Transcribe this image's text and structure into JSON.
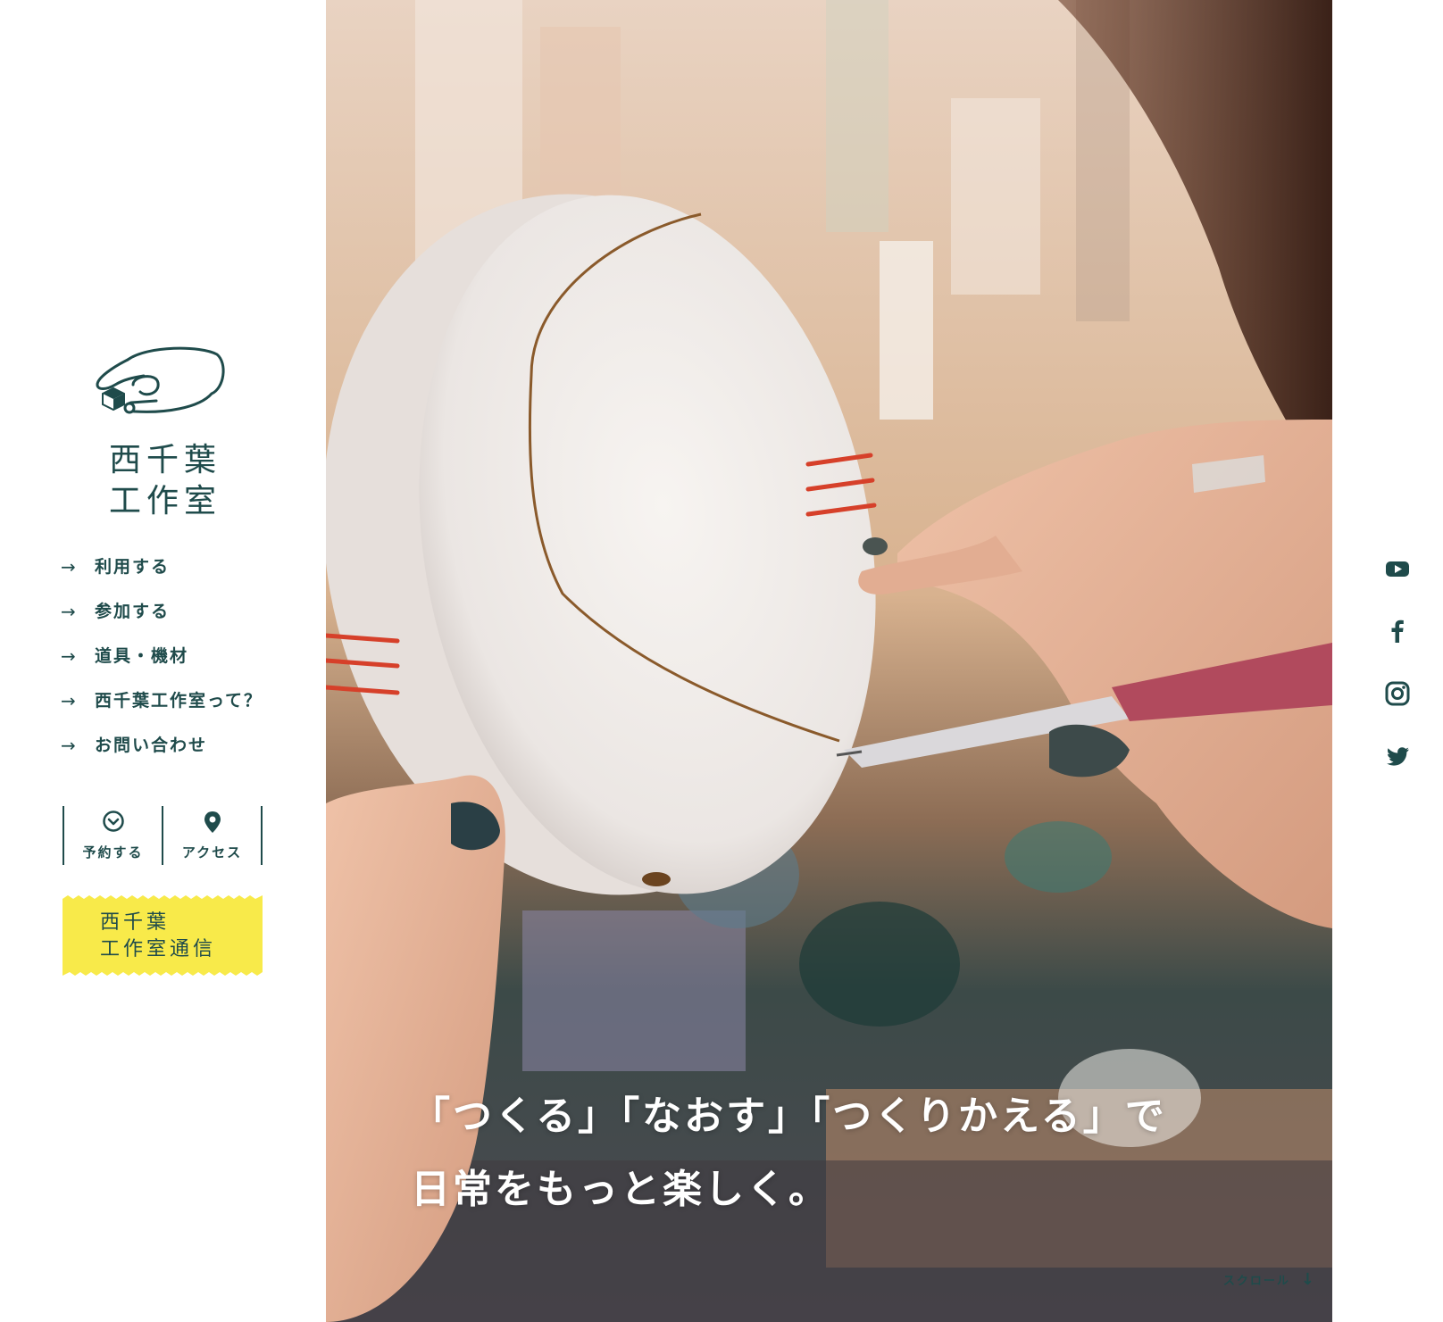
{
  "brand": {
    "logo_text_line1": "西千葉",
    "logo_text_line2": "工作室",
    "primary_color": "#1f4b4b",
    "accent_yellow": "#f8ea4a"
  },
  "nav": {
    "items": [
      {
        "arrow": "→",
        "label": "利用する"
      },
      {
        "arrow": "→",
        "label": "参加する"
      },
      {
        "arrow": "→",
        "label": "道具・機材"
      },
      {
        "arrow": "→",
        "label": "西千葉工作室って？"
      },
      {
        "arrow": "→",
        "label": "お問い合わせ"
      }
    ]
  },
  "quick_links": {
    "reserve": {
      "label": "予約する",
      "icon": "chevron-circle-icon"
    },
    "access": {
      "label": "アクセス",
      "icon": "map-pin-icon"
    }
  },
  "newsletter": {
    "line1": "西千葉",
    "line2": "工作室通信"
  },
  "hero": {
    "tagline_line1": "「つくる」「なおす」「つくりかえる」で",
    "tagline_line2": "日常をもっと楽しく。",
    "scroll_label": "スクロール",
    "scroll_arrow": "↓"
  },
  "social": {
    "items": [
      "youtube-icon",
      "facebook-icon",
      "instagram-icon",
      "twitter-icon"
    ]
  }
}
